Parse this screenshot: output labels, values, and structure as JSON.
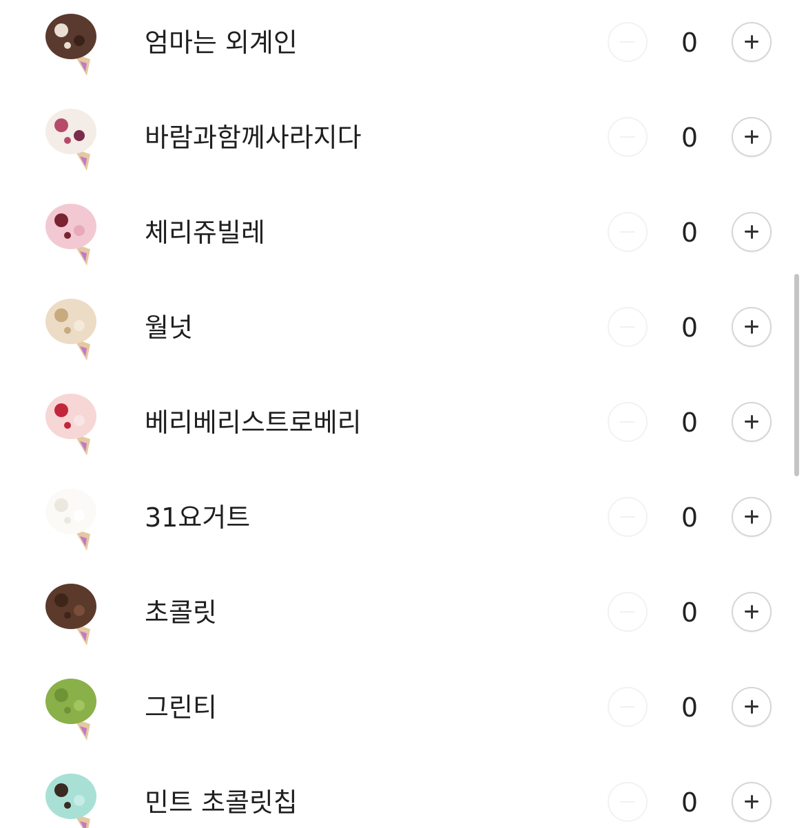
{
  "colors": {
    "background": "#ffffff",
    "text": "#1f1f1f",
    "plus_border": "#d6d6d6",
    "minus_border": "#f2f2f2",
    "scrollbar": "#c4c4c4"
  },
  "flavors": [
    {
      "name": "엄마는 외계인",
      "qty": "0",
      "scoop": [
        "#5a3a2e",
        "#e8dfd2",
        "#3b2219"
      ]
    },
    {
      "name": "바람과함께사라지다",
      "qty": "0",
      "scoop": [
        "#f4ece6",
        "#b64a6a",
        "#7a2c4a"
      ]
    },
    {
      "name": "체리쥬빌레",
      "qty": "0",
      "scoop": [
        "#f2c9d2",
        "#7a2433",
        "#e8a9b8"
      ]
    },
    {
      "name": "월넛",
      "qty": "0",
      "scoop": [
        "#ecdcc5",
        "#c9a97e",
        "#f5ead9"
      ]
    },
    {
      "name": "베리베리스트로베리",
      "qty": "0",
      "scoop": [
        "#f7d6d6",
        "#c2263a",
        "#f9e6e4"
      ]
    },
    {
      "name": "31요거트",
      "qty": "0",
      "scoop": [
        "#fbfaf6",
        "#ebe8e0",
        "#ffffff"
      ]
    },
    {
      "name": "초콜릿",
      "qty": "0",
      "scoop": [
        "#5b3a2b",
        "#3f2519",
        "#7a4e3a"
      ]
    },
    {
      "name": "그린티",
      "qty": "0",
      "scoop": [
        "#8ab04a",
        "#6e9436",
        "#a2c55d"
      ]
    },
    {
      "name": "민트 초콜릿칩",
      "qty": "0",
      "scoop": [
        "#a8e0d6",
        "#3a2a22",
        "#c6ede5"
      ]
    }
  ]
}
